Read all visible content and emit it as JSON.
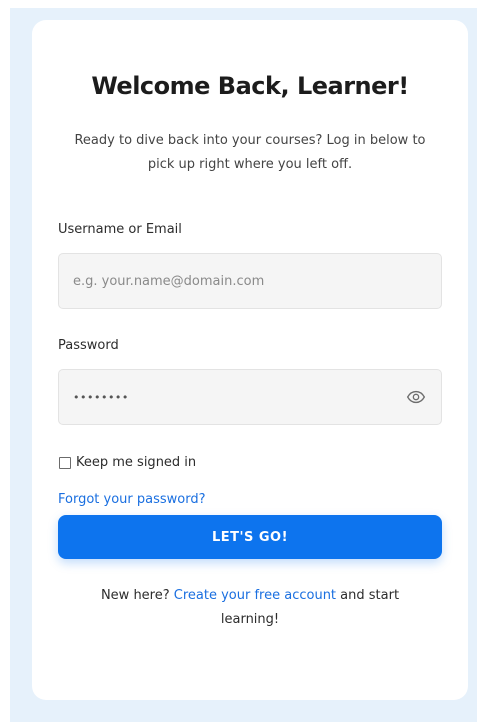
{
  "login": {
    "title": "Welcome Back, Learner!",
    "subtitle": "Ready to dive back into your courses? Log in below to pick up right where you left off.",
    "username_label": "Username or Email",
    "username_placeholder": "e.g. your.name@domain.com",
    "username_value": "",
    "password_label": "Password",
    "password_value": "password",
    "password_toggle_icon": "eye-icon",
    "remember_label": "Keep me signed in",
    "remember_checked": false,
    "forgot_link": "Forgot your password?",
    "submit_label": "LET'S GO!",
    "signup_prefix": "New here?",
    "signup_link": "Create your free account",
    "signup_suffix": "and start learning!"
  },
  "colors": {
    "accent": "#0d74ee",
    "link": "#1a6fe0",
    "backdrop": "#e6f1fb",
    "field_bg": "#f5f5f5"
  }
}
